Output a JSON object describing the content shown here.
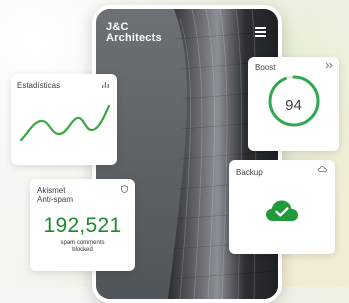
{
  "phone": {
    "title_line1": "J&C",
    "title_line2": "Architects"
  },
  "stats_card": {
    "title": "Estadísticas",
    "icon": "bar-chart-icon"
  },
  "akismet_card": {
    "title_line1": "Akismet",
    "title_line2": "Anti-spam",
    "icon": "shield-icon",
    "count": "192,521",
    "caption_line1": "spam comments",
    "caption_line2": "blocked"
  },
  "boost_card": {
    "title": "Boost",
    "icon": "chevrons-right-icon",
    "score": "94",
    "score_fraction": 0.94
  },
  "backup_card": {
    "title": "Backup",
    "icon": "cloud-icon",
    "status_icon": "cloud-check-icon"
  },
  "colors": {
    "accent_green": "#1f8a2d",
    "ring_green": "#2fa84f",
    "line_green": "#3aa845"
  }
}
